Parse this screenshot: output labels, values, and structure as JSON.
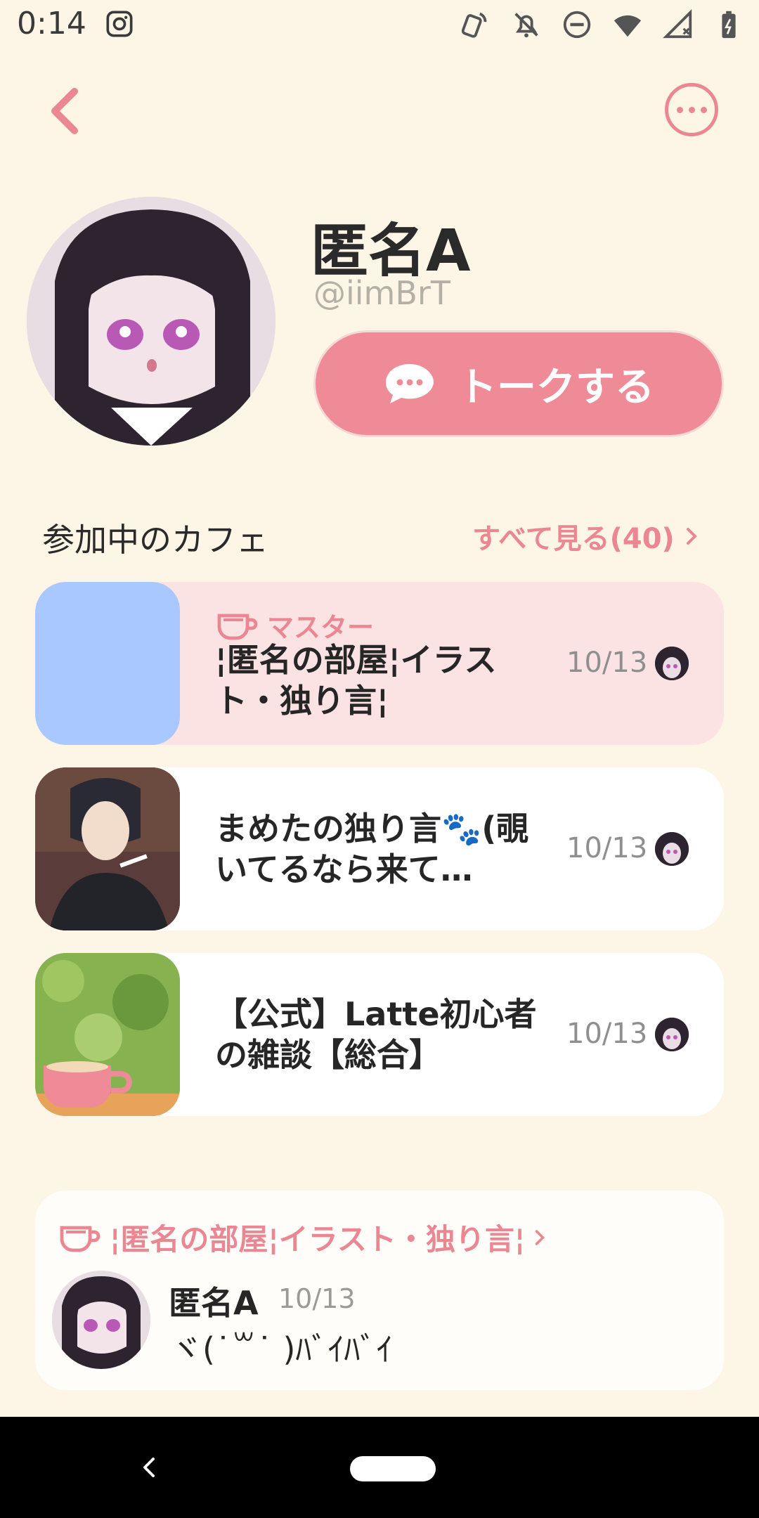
{
  "status_bar": {
    "time": "0:14",
    "icons": [
      "instagram-icon",
      "nfc-icon",
      "bell-off-icon",
      "dnd-icon",
      "wifi-icon",
      "signal-icon",
      "battery-icon"
    ]
  },
  "header": {
    "back_icon": "chevron-left-icon",
    "more_icon": "more-horizontal-icon"
  },
  "profile": {
    "name": "匿名A",
    "handle": "@iimBrT",
    "talk_button_label": "トークする"
  },
  "cafes_section": {
    "title": "参加中のカフェ",
    "see_all": "すべて見る(40)",
    "items": [
      {
        "badge": "マスター",
        "title": "¦匿名の部屋¦イラスト・独り言¦",
        "date": "10/13",
        "thumb_color": "#a9c8ff"
      },
      {
        "badge": "",
        "title": "まめたの独り言🐾(覗いてるなら来て…",
        "date": "10/13",
        "thumb_color": "#3b3640"
      },
      {
        "badge": "",
        "title": "【公式】Latte初心者の雑談【総合】",
        "date": "10/13",
        "thumb_color": "#7cab4e"
      }
    ]
  },
  "post": {
    "cafe_link": "¦匿名の部屋¦イラスト・独り言¦",
    "author": "匿名A",
    "date": "10/13",
    "text": "ヾ(˙꒳˙ )ﾊﾞｲﾊﾞｲ"
  },
  "colors": {
    "background": "#fdf6e6",
    "accent": "#ea8793",
    "owner_card": "#fbe3e4"
  }
}
